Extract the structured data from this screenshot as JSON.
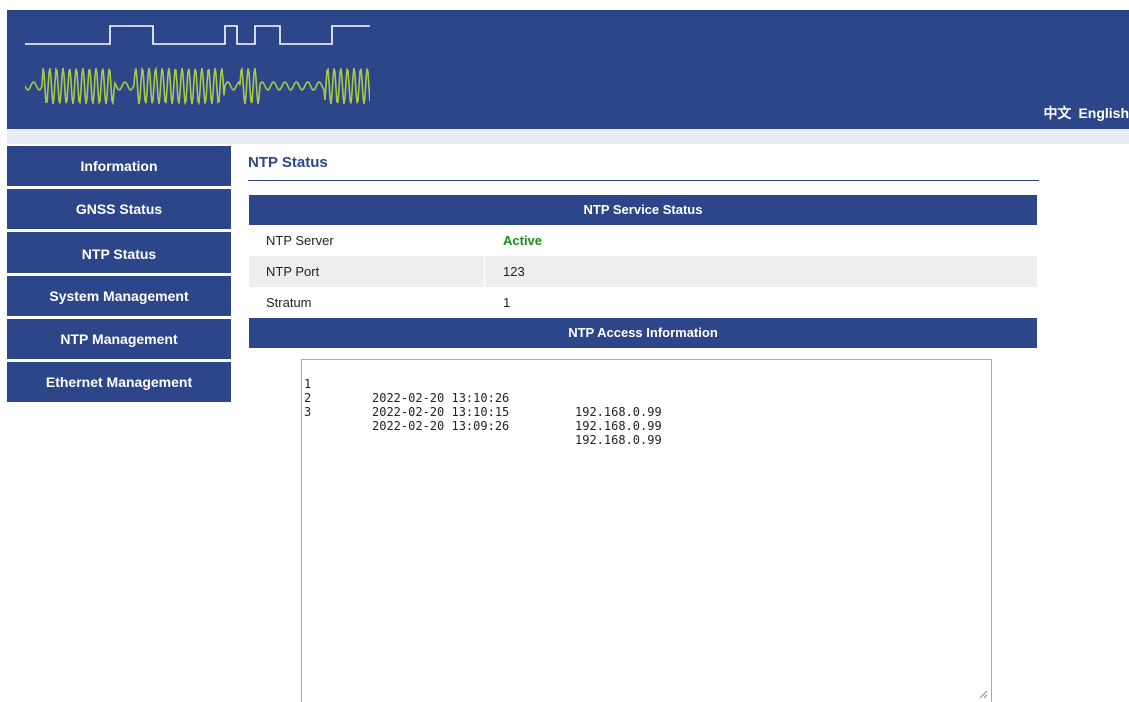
{
  "header": {
    "lang_zh": "中文",
    "lang_en": "English"
  },
  "sidebar": {
    "items": [
      {
        "label": "Information"
      },
      {
        "label": "GNSS Status"
      },
      {
        "label": "NTP Status"
      },
      {
        "label": "System Management"
      },
      {
        "label": "NTP Management"
      },
      {
        "label": "Ethernet Management"
      }
    ]
  },
  "main": {
    "title": "NTP Status",
    "service_status": {
      "heading": "NTP Service Status",
      "rows": [
        {
          "label": "NTP Server",
          "value": "Active"
        },
        {
          "label": "NTP Port",
          "value": "123"
        },
        {
          "label": "Stratum",
          "value": "1"
        }
      ]
    },
    "access_info": {
      "heading": "NTP Access Information",
      "log": [
        {
          "index": "1",
          "time": "2022-02-20 13:10:26",
          "ip": "192.168.0.99"
        },
        {
          "index": "2",
          "time": "2022-02-20 13:10:15",
          "ip": "192.168.0.99"
        },
        {
          "index": "3",
          "time": "2022-02-20 13:09:26",
          "ip": "192.168.0.99"
        }
      ]
    }
  },
  "colors": {
    "primary": "#2c4689",
    "active_green": "#1e8a1e",
    "logo_wave": "#a8c84a"
  }
}
